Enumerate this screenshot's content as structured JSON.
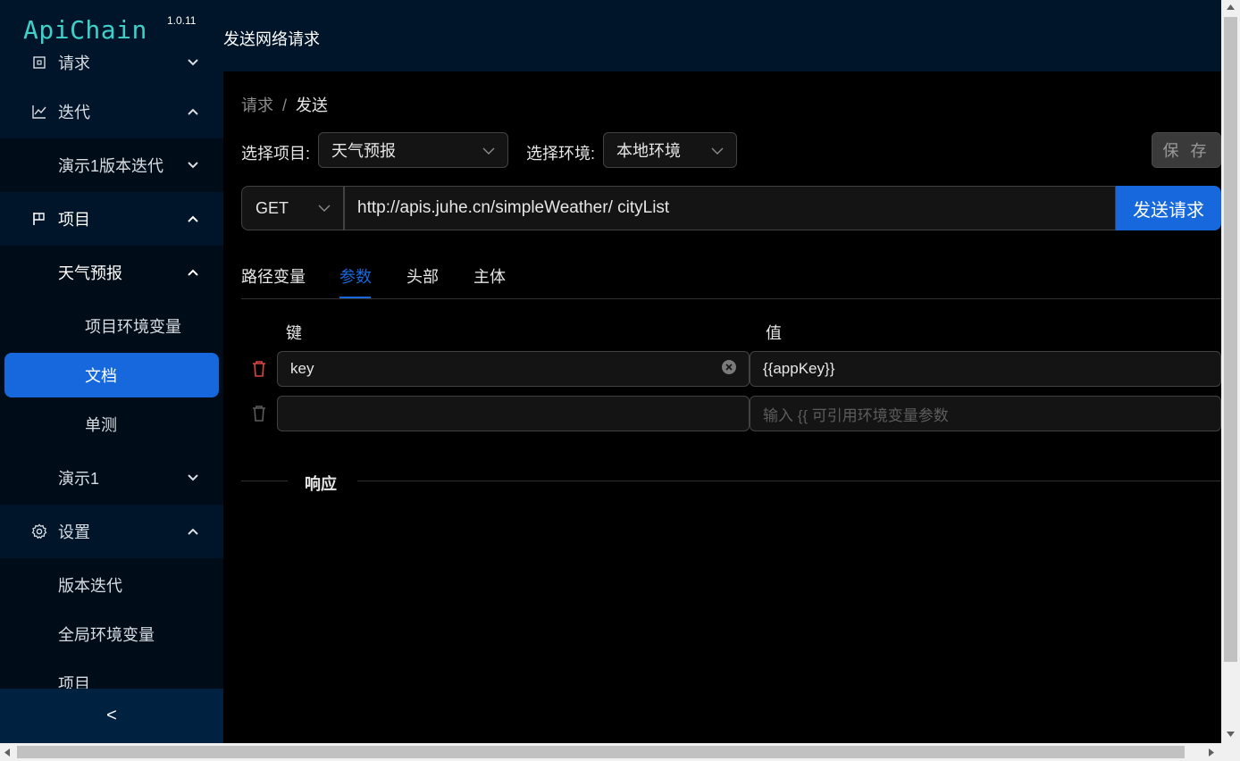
{
  "app": {
    "name": "ApiChain",
    "version": "1.0.11"
  },
  "header": {
    "title": "发送网络请求"
  },
  "sidebar": {
    "items": [
      {
        "label": "请求",
        "icon": "request-icon",
        "state": "collapsed"
      },
      {
        "label": "迭代",
        "icon": "chart-line-icon",
        "state": "expanded"
      },
      {
        "label": "演示1版本迭代",
        "state": "collapsed"
      },
      {
        "label": "项目",
        "icon": "flag-icon",
        "state": "expanded"
      },
      {
        "label": "天气预报",
        "state": "expanded"
      },
      {
        "label": "项目环境变量"
      },
      {
        "label": "文档",
        "selected": true
      },
      {
        "label": "单测"
      },
      {
        "label": "演示1",
        "state": "collapsed"
      },
      {
        "label": "设置",
        "icon": "gear-icon",
        "state": "expanded"
      },
      {
        "label": "版本迭代"
      },
      {
        "label": "全局环境变量"
      },
      {
        "label": "项目"
      }
    ],
    "collapse_label": "<"
  },
  "breadcrumb": {
    "parent": "请求",
    "separator": "/",
    "current": "发送"
  },
  "filters": {
    "project_label": "选择项目:",
    "project_value": "天气预报",
    "env_label": "选择环境:",
    "env_value": "本地环境"
  },
  "toolbar": {
    "save_label": "保 存"
  },
  "request": {
    "method": "GET",
    "url": "http://apis.juhe.cn/simpleWeather/ cityList",
    "send_label": "发送请求"
  },
  "tabs": [
    {
      "label": "路径变量"
    },
    {
      "label": "参数",
      "active": true
    },
    {
      "label": "头部"
    },
    {
      "label": "主体"
    }
  ],
  "params": {
    "key_header": "键",
    "value_header": "值",
    "rows": [
      {
        "key": "key",
        "value": "{{appKey}}"
      },
      {
        "key": "",
        "value": ""
      }
    ],
    "value_placeholder": "输入 {{ 可引用环境变量参数"
  },
  "response": {
    "label": "响应"
  },
  "colors": {
    "accent": "#1668dc",
    "sidebar_bg": "#001529",
    "danger": "#dc4446",
    "logo": "#3fd0c9"
  }
}
